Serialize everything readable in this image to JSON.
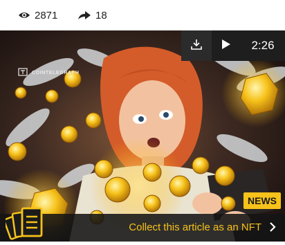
{
  "stats": {
    "views": "2871",
    "shares": "18"
  },
  "video": {
    "duration": "2:26"
  },
  "brand": "COINTELEGRAPH",
  "badge": "NEWS",
  "cta": {
    "label": "Collect this article as an NFT"
  },
  "colors": {
    "accent": "#f7c21a",
    "dark": "#1e1e1e"
  },
  "icons": [
    "eye-icon",
    "share-arrow-icon",
    "download-icon",
    "play-icon",
    "chevron-right-icon",
    "nft-cards-icon"
  ]
}
